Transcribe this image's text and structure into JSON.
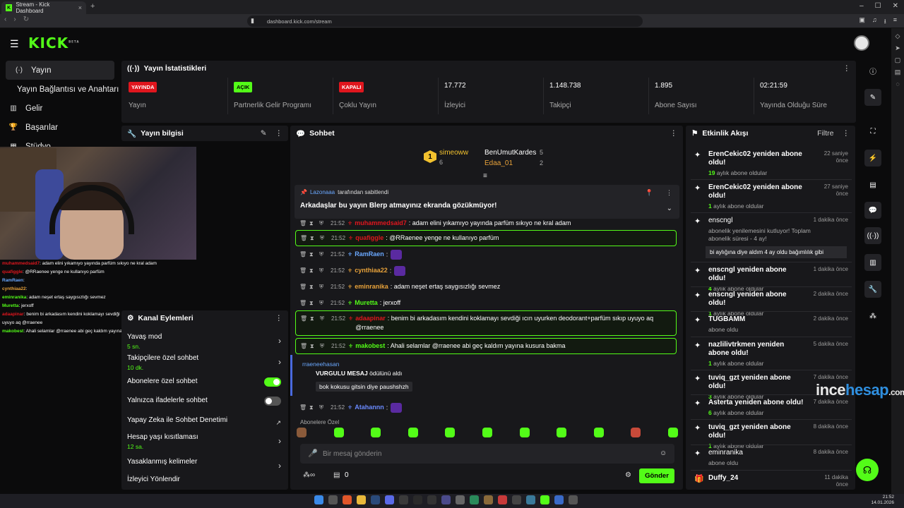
{
  "browser": {
    "tab_title": "Stream - Kick Dashboard",
    "url": "dashboard.kick.com/stream"
  },
  "kick": {
    "logo": "KICK",
    "logo_badge": "BETA"
  },
  "nav": {
    "items": [
      {
        "label": "Yayın",
        "icon": "broadcast-icon"
      },
      {
        "label": "Yayın Bağlantısı ve Anahtarı",
        "icon": ""
      },
      {
        "label": "Gelir",
        "icon": "revenue-icon"
      },
      {
        "label": "Başarılar",
        "icon": "trophy-icon"
      },
      {
        "label": "Stüdyo",
        "icon": "studio-icon"
      }
    ]
  },
  "overlay_chat": [
    {
      "user": "muhammedsaid7",
      "text": ": adam elini yıkamıyo yayında parfüm sıkıyo ne kral adam",
      "color": "#e0161e"
    },
    {
      "user": "quafiggle",
      "text": ": @RRaenee yenge ne kullanıyo parfüm",
      "color": "#e0161e"
    },
    {
      "user": "RamRaen",
      "text": ":",
      "color": "#6aa8ff"
    },
    {
      "user": "cynthiaa22",
      "text": ":",
      "color": "#e8a23a"
    },
    {
      "user": "eminranika",
      "text": ": adam neşet ertaş saygısızlığı sevmez",
      "color": "#53fc18"
    },
    {
      "user": "Muretta",
      "text": ": jerxoff",
      "color": "#53fc18"
    },
    {
      "user": "adaapinar",
      "text": ": benim bi arkadasım kendini koklamayı sevdiği ıcın uyurken deodorant+parfüm sıkıp uyuyo aq @rraenee",
      "color": "#e0161e"
    },
    {
      "user": "makobest",
      "text": ": Ahali selamlar @rraenee abi geç kaldım yayına kusura bakma",
      "color": "#53fc18"
    }
  ],
  "stats": {
    "title": "Yayın İstatistikleri",
    "items": [
      {
        "badge": "YAYINDA",
        "badge_type": "red",
        "label": "Yayın"
      },
      {
        "badge": "AÇIK",
        "badge_type": "green",
        "label": "Partnerlik Gelir Programı"
      },
      {
        "badge": "KAPALI",
        "badge_type": "red",
        "label": "Çoklu Yayın"
      },
      {
        "value": "17.772",
        "label": "İzleyici"
      },
      {
        "value": "1.148.738",
        "label": "Takipçi"
      },
      {
        "value": "1.895",
        "label": "Abone Sayısı"
      },
      {
        "value": "02:21:59",
        "label": "Yayında Olduğu Süre"
      }
    ]
  },
  "yayin_bilgisi": {
    "title": "Yayın bilgisi"
  },
  "kanal": {
    "title": "Kanal Eylemleri",
    "rows": [
      {
        "label": "Yavaş mod",
        "sub": "5 sn."
      },
      {
        "label": "Takipçilere özel sohbet",
        "sub": "10 dk."
      },
      {
        "label": "Abonelere özel sohbet",
        "sub": ""
      },
      {
        "label": "Yalnızca ifadelerle sohbet",
        "sub": ""
      },
      {
        "label": "Yapay Zeka ile Sohbet Denetimi",
        "sub": ""
      },
      {
        "label": "Hesap yaşı kısıtlaması",
        "sub": "12 sa."
      },
      {
        "label": "Yasaklanmış kelimeler",
        "sub": ""
      },
      {
        "label": "İzleyici Yönlendir",
        "sub": ""
      }
    ],
    "toggles": {
      "abonelere": "on",
      "ifadelerle": "off"
    }
  },
  "chat": {
    "title": "Sohbet",
    "leaders": [
      {
        "rank": "1",
        "name": "simeoww",
        "count": "6"
      },
      {
        "name": "BenUmutKardes",
        "count": "5"
      },
      {
        "name": "Edaa_01",
        "count": "2"
      }
    ],
    "pinned": {
      "by_user": "Lazonaaa",
      "by_text": "tarafından sabitlendi",
      "text": "Arkadaşlar bu yayın Blerp atmayınız ekranda gözükmüyor!"
    },
    "messages": [
      {
        "time": "21:52",
        "user": "muhammedsaid7",
        "text": ": adam elini yıkamıyo yayında parfüm sıkıyo ne kral adam",
        "color": "#e0161e",
        "hl": false
      },
      {
        "time": "21:52",
        "user": "quafiggle",
        "text": ": @RRaenee yenge ne kullanıyo parfüm",
        "color": "#e0161e",
        "hl": true
      },
      {
        "time": "21:52",
        "user": "RamRaen",
        "text": ":",
        "color": "#6aa8ff",
        "hl": false,
        "emote": true
      },
      {
        "time": "21:52",
        "user": "cynthiaa22",
        "text": ":",
        "color": "#e8a23a",
        "hl": false,
        "emote": true
      },
      {
        "time": "21:52",
        "user": "eminranika",
        "text": ": adam neşet ertaş saygısızlığı sevmez",
        "color": "#e8a23a",
        "hl": false
      },
      {
        "time": "21:52",
        "user": "Muretta",
        "text": ": jerxoff",
        "color": "#53fc18",
        "hl": false
      },
      {
        "time": "21:52",
        "user": "adaapinar",
        "text": ": benim bi arkadasım kendini koklamayı sevdiği ıcın uyurken deodorant+parfüm sıkıp uyuyo aq @rraenee",
        "color": "#e0161e",
        "hl": true
      },
      {
        "time": "21:52",
        "user": "makobest",
        "text": ": Ahali selamlar @rraenee abi geç kaldım yayına kusura bakma",
        "color": "#53fc18",
        "hl": true
      },
      {
        "time": "21:52",
        "user": "Atahannn",
        "text": ":",
        "color": "#6a8aff",
        "hl": false,
        "emote": true
      }
    ],
    "redeem": {
      "user": "rraeneehasan",
      "title": "VURGULU MESAJ",
      "title_suffix": "ödülünü aldı",
      "text": "bok kokusu gitsin diye paushshzh"
    },
    "emote_section": "Abonelere Özel",
    "input_placeholder": "Bir mesaj gönderin",
    "kicks_count": "0",
    "send_label": "Gönder"
  },
  "activity": {
    "title": "Etkinlik Akışı",
    "filter": "Filtre",
    "items": [
      {
        "title": "ErenCekic02 yeniden abone oldu!",
        "sub_num": "19",
        "sub": "aylık abone oldular",
        "when": "22 saniye önce"
      },
      {
        "title": "ErenCekic02 yeniden abone oldu!",
        "sub_num": "1",
        "sub": "aylık abone oldular",
        "when": "27 saniye önce"
      },
      {
        "title": "enscngl",
        "sub_num": "",
        "sub": "abonelik yenilemesini kutluyor! Toplam abonelik süresi - 4 ay!",
        "when": "1 dakika önce",
        "quote": "bi aylığına diye aldım 4 ay oldu bağımlılık gibi"
      },
      {
        "title": "enscngl yeniden abone oldu!",
        "sub_num": "4",
        "sub": "aylık abone oldular",
        "when": "1 dakika önce"
      },
      {
        "title": "enscngl yeniden abone oldu!",
        "sub_num": "1",
        "sub": "aylık abone oldular",
        "when": "2 dakika önce"
      },
      {
        "title": "TUGBAMM",
        "sub_num": "",
        "sub": "abone oldu",
        "when": "2 dakika önce"
      },
      {
        "title": "nazlilivtrkmen yeniden abone oldu!",
        "sub_num": "1",
        "sub": "aylık abone oldular",
        "when": "5 dakika önce"
      },
      {
        "title": "tuviq_gzt yeniden abone oldu!",
        "sub_num": "3",
        "sub": "aylık abone oldular",
        "when": "7 dakika önce"
      },
      {
        "title": "Asterta yeniden abone oldu!",
        "sub_num": "6",
        "sub": "aylık abone oldular",
        "when": "7 dakika önce"
      },
      {
        "title": "tuviq_gzt yeniden abone oldu!",
        "sub_num": "1",
        "sub": "aylık abone oldular",
        "when": "8 dakika önce"
      },
      {
        "title": "eminranika",
        "sub_num": "",
        "sub": "abone oldu",
        "when": "8 dakika önce"
      },
      {
        "title": "Duffy_24",
        "sub_num": "",
        "sub": "",
        "when": "11 dakika önce"
      }
    ]
  },
  "watermark": {
    "a": "ince",
    "b": "hesap",
    "c": ".com"
  },
  "clock": {
    "time": "21:52",
    "date": "14.01.2026"
  },
  "colors": {
    "accent": "#53fc18",
    "panel": "#18181b",
    "bg": "#0b0b0c",
    "danger": "#e0161e"
  }
}
